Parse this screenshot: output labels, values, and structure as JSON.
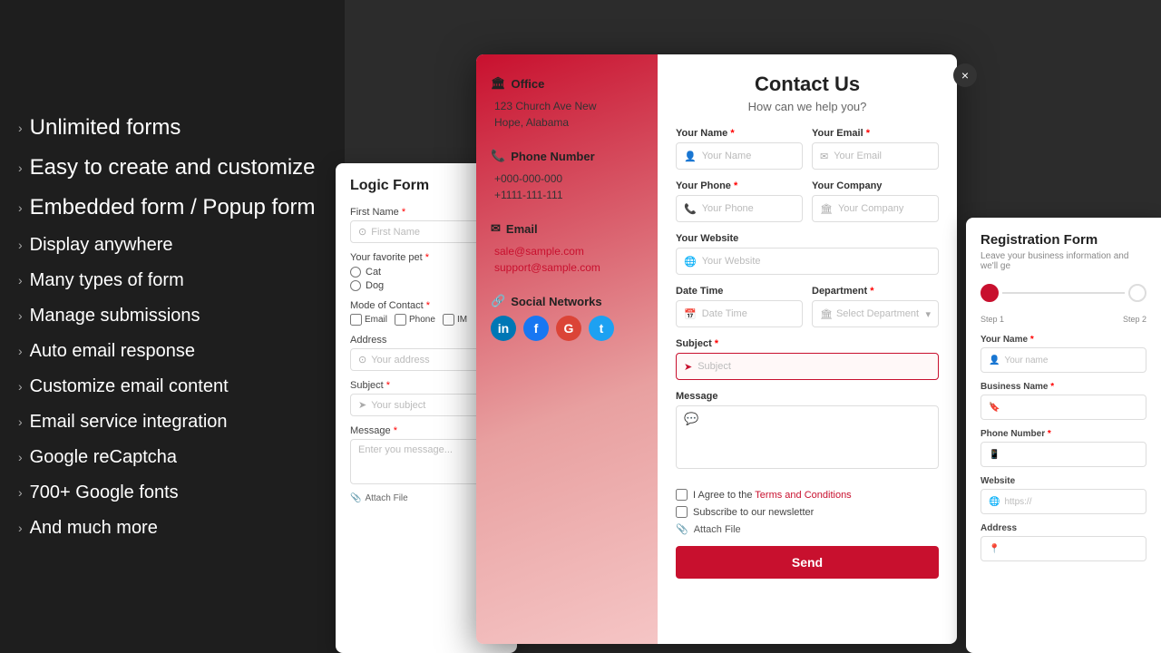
{
  "leftPanel": {
    "features": [
      {
        "id": "unlimited-forms",
        "text": "Unlimited forms",
        "large": true
      },
      {
        "id": "easy-create",
        "text": "Easy to create and customize",
        "large": true
      },
      {
        "id": "embedded-popup",
        "text": "Embedded form / Popup form",
        "large": true
      },
      {
        "id": "display-anywhere",
        "text": "Display anywhere",
        "large": false
      },
      {
        "id": "many-types",
        "text": "Many types of form",
        "large": false
      },
      {
        "id": "manage-submissions",
        "text": "Manage submissions",
        "large": false
      },
      {
        "id": "auto-email",
        "text": "Auto email response",
        "large": false
      },
      {
        "id": "customize-email",
        "text": "Customize email content",
        "large": false
      },
      {
        "id": "email-integration",
        "text": "Email service integration",
        "large": false
      },
      {
        "id": "recaptcha",
        "text": "Google reCaptcha",
        "large": false
      },
      {
        "id": "google-fonts",
        "text": "700+ Google fonts",
        "large": false
      },
      {
        "id": "much-more",
        "text": "And much more",
        "large": false
      }
    ]
  },
  "logicForm": {
    "title": "Logic Form",
    "firstNameLabel": "First Name",
    "firstNamePlaceholder": "First Name",
    "petLabel": "Your favorite pet",
    "petOptions": [
      "Cat",
      "Dog"
    ],
    "contactLabel": "Mode of Contact",
    "contactOptions": [
      "Email",
      "Phone",
      "IM"
    ],
    "addressLabel": "Address",
    "addressPlaceholder": "Your address",
    "subjectLabel": "Subject",
    "subjectPlaceholder": "Your subject",
    "messageLabel": "Message",
    "messagePlaceholder": "Enter you message...",
    "attachLabel": "Attach File"
  },
  "contactModal": {
    "closeLabel": "×",
    "leftSections": [
      {
        "id": "office",
        "icon": "🏛",
        "title": "Office",
        "lines": [
          "123 Church Ave New",
          "Hope, Alabama"
        ]
      },
      {
        "id": "phone",
        "icon": "📞",
        "title": "Phone Number",
        "lines": [
          "+000-000-000",
          "+1111-111-111"
        ]
      },
      {
        "id": "email",
        "icon": "✉",
        "title": "Email",
        "lines": [
          "sale@sample.com",
          "support@sample.com"
        ]
      },
      {
        "id": "social",
        "icon": "🔗",
        "title": "Social Networks"
      }
    ],
    "socialIcons": [
      {
        "name": "LinkedIn",
        "class": "si-linkedin",
        "label": "in"
      },
      {
        "name": "Facebook",
        "class": "si-facebook",
        "label": "f"
      },
      {
        "name": "Google",
        "class": "si-google",
        "label": "G"
      },
      {
        "name": "Twitter",
        "class": "si-twitter",
        "label": "t"
      }
    ],
    "right": {
      "title": "Contact Us",
      "subtitle": "How can we help you?",
      "fields": [
        {
          "id": "your-name",
          "label": "Your Name",
          "req": true,
          "placeholder": "Your Name",
          "icon": "👤"
        },
        {
          "id": "your-email",
          "label": "Your Email",
          "req": true,
          "placeholder": "Your Email",
          "icon": "✉"
        },
        {
          "id": "your-phone",
          "label": "Your Phone",
          "req": true,
          "placeholder": "Your Phone",
          "icon": "📞"
        },
        {
          "id": "your-company",
          "label": "Your Company",
          "req": false,
          "placeholder": "Your Company",
          "icon": "🏛"
        },
        {
          "id": "your-website",
          "label": "Your Website",
          "req": false,
          "placeholder": "Your Website",
          "icon": "🌐",
          "full": true
        },
        {
          "id": "date-time",
          "label": "Date Time",
          "req": false,
          "placeholder": "Date Time",
          "icon": "📅"
        },
        {
          "id": "department",
          "label": "Department",
          "req": true,
          "placeholder": "Select Department",
          "icon": "🏛",
          "select": true
        },
        {
          "id": "subject",
          "label": "Subject",
          "req": true,
          "placeholder": "Subject",
          "icon": "➤",
          "highlight": true
        },
        {
          "id": "message",
          "label": "Message",
          "req": false,
          "placeholder": "",
          "textarea": true
        }
      ],
      "checkboxes": [
        {
          "id": "terms",
          "label": "I Agree to the ",
          "link": "Terms and Conditions"
        },
        {
          "id": "newsletter",
          "label": "Subscribe to our newsletter"
        }
      ],
      "attachLabel": "Attach File",
      "sendLabel": "Send"
    }
  },
  "regForm": {
    "title": "Registration Form",
    "subtitle": "Leave your business information and we'll ge",
    "steps": [
      "Step 1",
      "Step 2"
    ],
    "fields": [
      {
        "id": "your-name",
        "label": "Your Name",
        "req": true,
        "placeholder": "Your name",
        "icon": "👤"
      },
      {
        "id": "business-name",
        "label": "Business Name",
        "req": true,
        "placeholder": "",
        "icon": "🔖"
      },
      {
        "id": "phone-number",
        "label": "Phone Number",
        "req": true,
        "placeholder": "",
        "icon": "📱"
      },
      {
        "id": "website",
        "label": "Website",
        "req": false,
        "placeholder": "https://",
        "icon": "🌐"
      },
      {
        "id": "address",
        "label": "Address",
        "req": false,
        "placeholder": "",
        "icon": "📍"
      }
    ]
  }
}
